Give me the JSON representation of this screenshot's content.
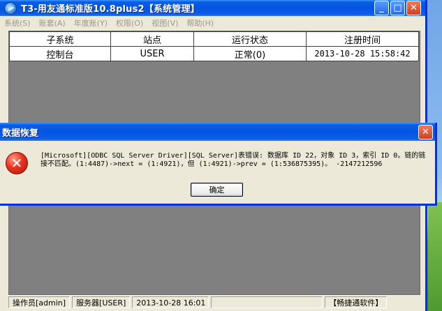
{
  "main_window": {
    "title": "T3-用友通标准版10.8plus2【系统管理】",
    "buttons": {
      "minimize": "_",
      "maximize": "□",
      "close": "✕"
    }
  },
  "menu": [
    {
      "label": "系统(S)"
    },
    {
      "label": "账套(A)"
    },
    {
      "label": "年度账(Y)"
    },
    {
      "label": "权限(O)"
    },
    {
      "label": "视图(V)"
    },
    {
      "label": "帮助(H)"
    }
  ],
  "table": {
    "columns": [
      "子系统",
      "站点",
      "运行状态",
      "注册时间"
    ],
    "rows": [
      [
        "控制台",
        "USER",
        "正常(0)",
        "2013-10-28 15:58:42"
      ]
    ]
  },
  "status_bar": {
    "operator": "操作员[admin]",
    "server": "服务器[USER]",
    "datetime": "2013-10-28 16:01",
    "brand": "【畅捷通软件】"
  },
  "dialog": {
    "title": "数据恢复",
    "close": "✕",
    "icon": "error-icon",
    "message": "[Microsoft][ODBC SQL Server Driver][SQL Server]表错误: 数据库 ID 22，对象 ID 3，索引 ID 0。链的链接不匹配。(1:4487)->next = (1:4921)，但 (1:4921)->prev = (1:536875395)。 -2147212596",
    "ok_label": "确定"
  },
  "colors": {
    "titlebar": "#0454e0",
    "window_face": "#ece9d8",
    "grid_background": "#808080",
    "close_button": "#d0401e"
  }
}
